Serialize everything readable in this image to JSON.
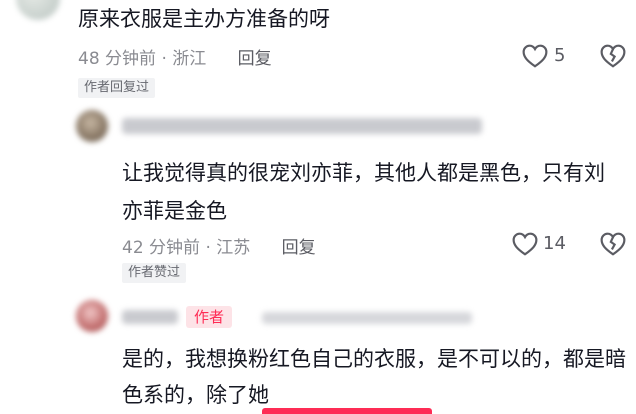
{
  "comment1": {
    "text": "原来衣服是主办方准备的呀",
    "time": "48 分钟前",
    "location": "· 浙江",
    "reply_label": "回复",
    "likes": "5",
    "tag": "作者回复过"
  },
  "comment2": {
    "text": "让我觉得真的很宠刘亦菲，其他人都是黑色，只有刘亦菲是金色",
    "time": "42 分钟前",
    "location": "· 江苏",
    "reply_label": "回复",
    "likes": "14",
    "tag": "作者赞过"
  },
  "comment3": {
    "author_badge": "作者",
    "text": "是的，我想换粉红色自己的衣服，是不可以的，都是暗色系的，除了她"
  },
  "colors": {
    "accent": "#fe2c55",
    "meta_gray": "#8a8b91",
    "text": "#161823",
    "tag_bg": "#f1f2f4"
  },
  "icons": [
    "heart-outline-icon",
    "broken-heart-icon"
  ]
}
